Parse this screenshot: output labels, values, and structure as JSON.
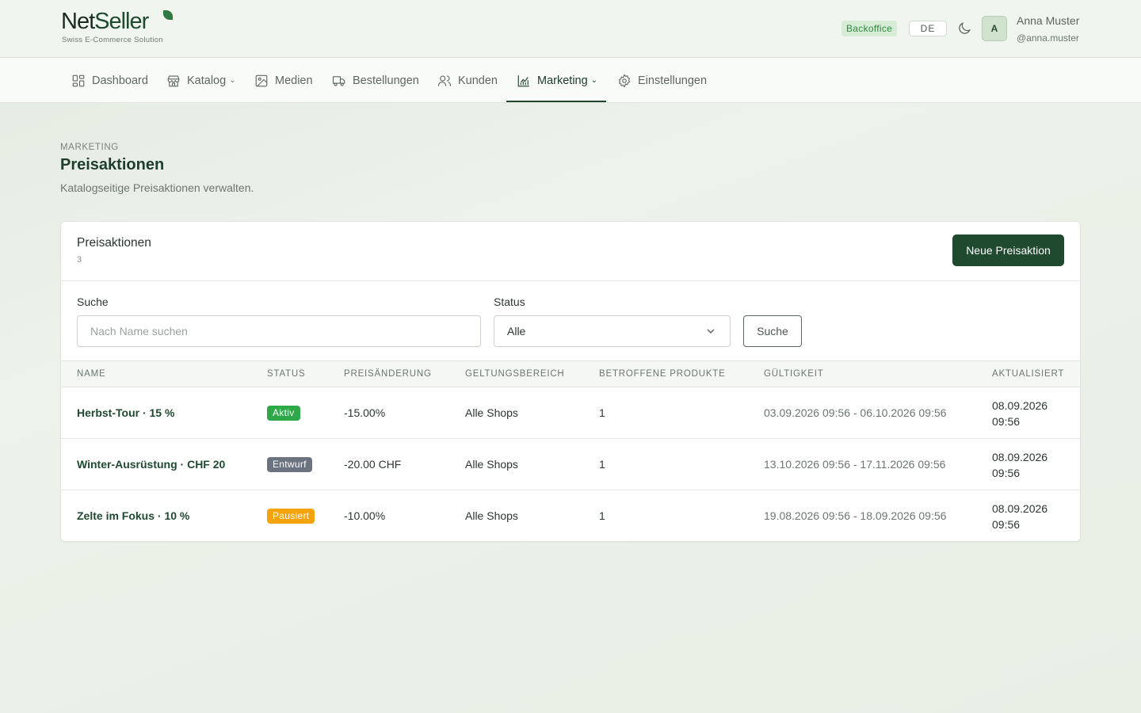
{
  "header": {
    "logo_main_dark": "Net",
    "logo_main_accent": "Seller",
    "logo_sub": "Swiss E-Commerce Solution",
    "badge": "Backoffice",
    "language": "DE",
    "user": {
      "initial": "A",
      "name": "Anna Muster",
      "handle": "@anna.muster"
    }
  },
  "nav": {
    "items": [
      {
        "label": "Dashboard",
        "icon": "grid-icon"
      },
      {
        "label": "Katalog",
        "icon": "store-icon",
        "dropdown": true
      },
      {
        "label": "Medien",
        "icon": "image-icon"
      },
      {
        "label": "Bestellungen",
        "icon": "truck-icon"
      },
      {
        "label": "Kunden",
        "icon": "users-icon"
      },
      {
        "label": "Marketing",
        "icon": "chart-icon",
        "dropdown": true,
        "active": true
      },
      {
        "label": "Einstellungen",
        "icon": "gear-icon"
      }
    ]
  },
  "page": {
    "breadcrumb": "MARKETING",
    "title": "Preisaktionen",
    "description": "Katalogseitige Preisaktionen verwalten."
  },
  "card": {
    "title": "Preisaktionen",
    "count": "3",
    "new_button": "Neue Preisaktion",
    "filters": {
      "search_label": "Suche",
      "search_placeholder": "Nach Name suchen",
      "status_label": "Status",
      "status_value": "Alle",
      "submit": "Suche"
    },
    "columns": [
      "NAME",
      "STATUS",
      "PREISÄNDERUNG",
      "GELTUNGSBEREICH",
      "BETROFFENE PRODUKTE",
      "GÜLTIGKEIT",
      "AKTUALISIERT"
    ],
    "rows": [
      {
        "name": "Herbst-Tour · 15 %",
        "status": "Aktiv",
        "status_color": "#2fa84a",
        "change": "-15.00%",
        "scope": "Alle Shops",
        "products": "1",
        "validity": "03.09.2026 09:56 - 06.10.2026 09:56",
        "updated": "08.09.2026 09:56"
      },
      {
        "name": "Winter-Ausrüstung · CHF 20",
        "status": "Entwurf",
        "status_color": "#6b7280",
        "change": "-20.00 CHF",
        "scope": "Alle Shops",
        "products": "1",
        "validity": "13.10.2026 09:56 - 17.11.2026 09:56",
        "updated": "08.09.2026 09:56"
      },
      {
        "name": "Zelte im Fokus · 10 %",
        "status": "Pausiert",
        "status_color": "#f5a30a",
        "change": "-10.00%",
        "scope": "Alle Shops",
        "products": "1",
        "validity": "19.08.2026 09:56 - 18.09.2026 09:56",
        "updated": "08.09.2026 09:56"
      }
    ]
  }
}
